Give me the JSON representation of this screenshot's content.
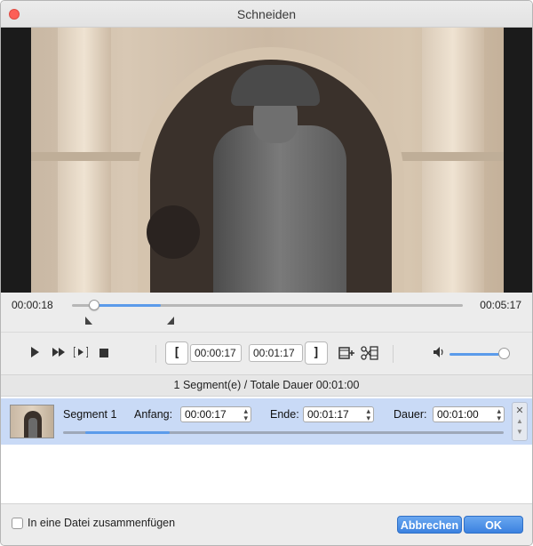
{
  "window": {
    "title": "Schneiden"
  },
  "timeline": {
    "current_time": "00:00:18",
    "total_time": "00:05:17",
    "playhead_fraction": 0.057,
    "selection_start_fraction": 0.054,
    "selection_end_fraction": 0.227
  },
  "controls": {
    "start_bracket": "[",
    "end_bracket": "]",
    "start_time": "00:00:17",
    "end_time": "00:01:17",
    "volume_fraction": 1.0
  },
  "segments_summary": "1 Segment(e) / Totale Dauer 00:01:00",
  "segments": [
    {
      "name": "Segment 1",
      "start_label": "Anfang:",
      "start_value": "00:00:17",
      "end_label": "Ende:",
      "end_value": "00:01:17",
      "duration_label": "Dauer:",
      "duration_value": "00:01:00"
    }
  ],
  "footer": {
    "merge_label": "In eine Datei zusammenfügen",
    "merge_checked": false,
    "cancel_label": "Abbrechen",
    "ok_label": "OK"
  },
  "colors": {
    "accent": "#5b9bea",
    "selection_row": "#c9daf6",
    "close_button": "#fc5f57"
  },
  "icons": {
    "play": "play-icon",
    "fast_forward": "fast-forward-icon",
    "play_segment": "play-segment-icon",
    "stop": "stop-icon",
    "add_segment": "add-segment-icon",
    "cut": "cut-icon",
    "volume": "volume-icon"
  }
}
